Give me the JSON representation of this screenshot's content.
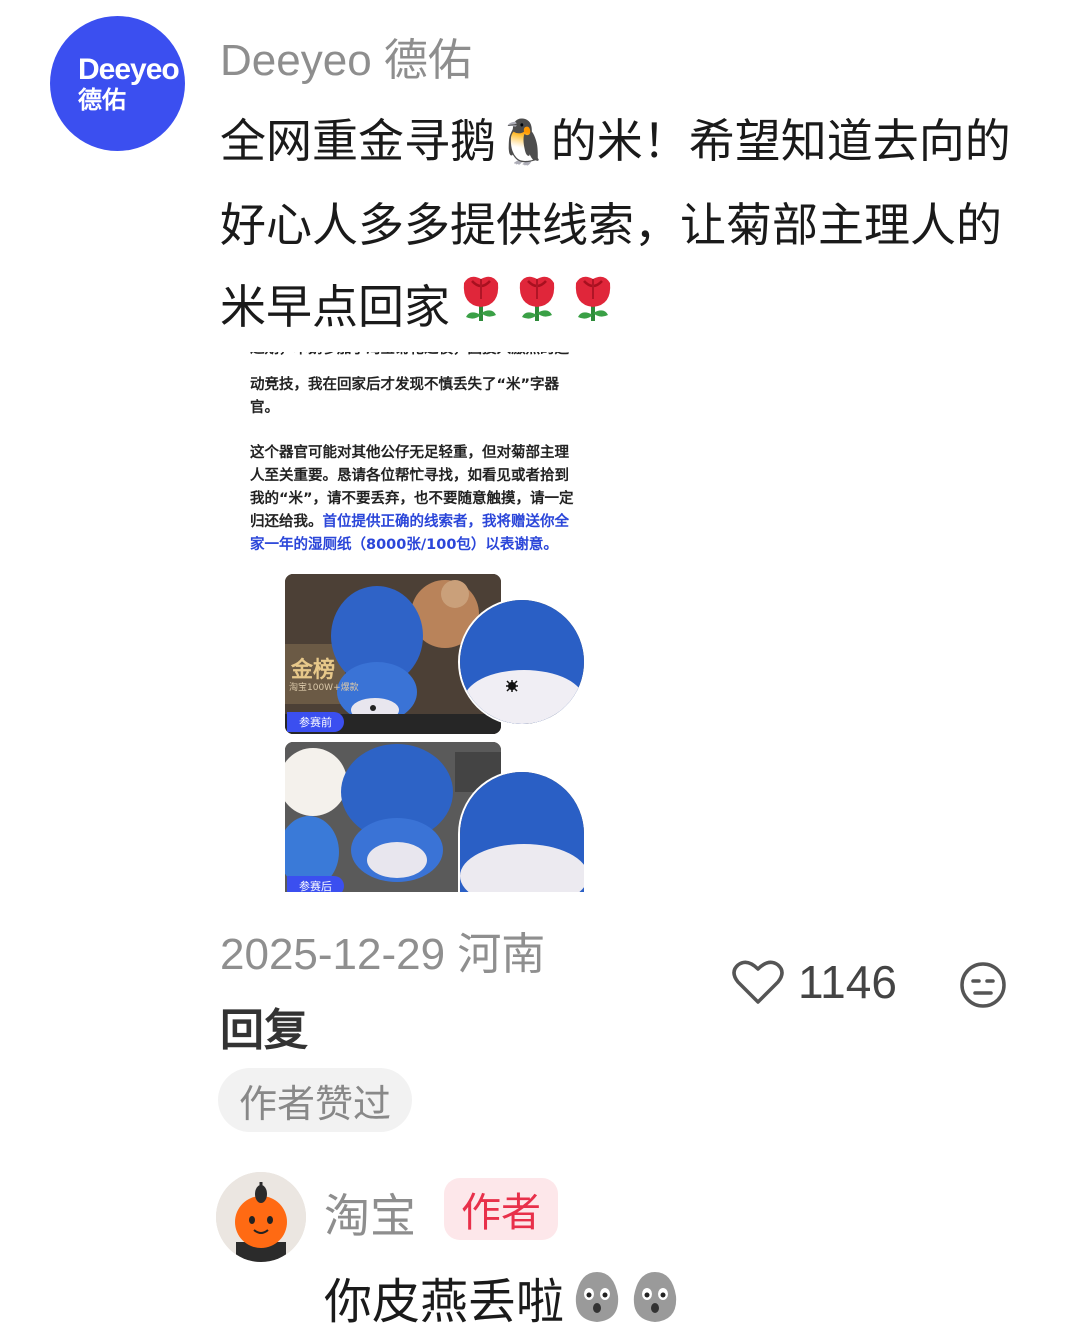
{
  "comment": {
    "avatar_line1": "Deeyeo",
    "avatar_line2": "德佑",
    "username": "Deeyeo 德佑",
    "text_part1": "全网重金寻鹅",
    "text_emoji": "🐧",
    "text_part2": "的米！希望知道去向的好心人多多提供线索，让菊部主理人的米早点回家",
    "rose_icon_count": 3,
    "date": "2025-12-29",
    "location": "河南",
    "reply_label": "回复",
    "like_count": "1146",
    "author_liked_badge": "作者赞过"
  },
  "attached_image": {
    "top_cut_line": "近期，本鹅参加了淘宝菊花之夜，因投入激烈的运",
    "paragraph1": "动竞技，我在回家后才发现不慎丢失了“米”字器官。",
    "paragraph2_black": "这个器官可能对其他公仔无足轻重，但对菊部主理人至关重要。恳请各位帮忙寻找，如看见或者拾到我的“米”，请不要丢弃，也不要随意触摸，请一定归还给我。",
    "paragraph2_blue": "首位提供正确的线索者，我将赠送你全家一年的湿厕纸（8000张/100包）以表谢意。",
    "photo1_label": "参赛前",
    "photo2_label": "参赛后",
    "bg_sign_text": "金榜",
    "bg_sign_subtext": "淘宝100W+爆款"
  },
  "reply": {
    "username": "淘宝",
    "author_tag": "作者",
    "text": "你皮燕丢啦"
  },
  "colors": {
    "brand_blue": "#3b4ff0",
    "author_red": "#e8304a",
    "meta_gray": "#8f8f8f"
  }
}
